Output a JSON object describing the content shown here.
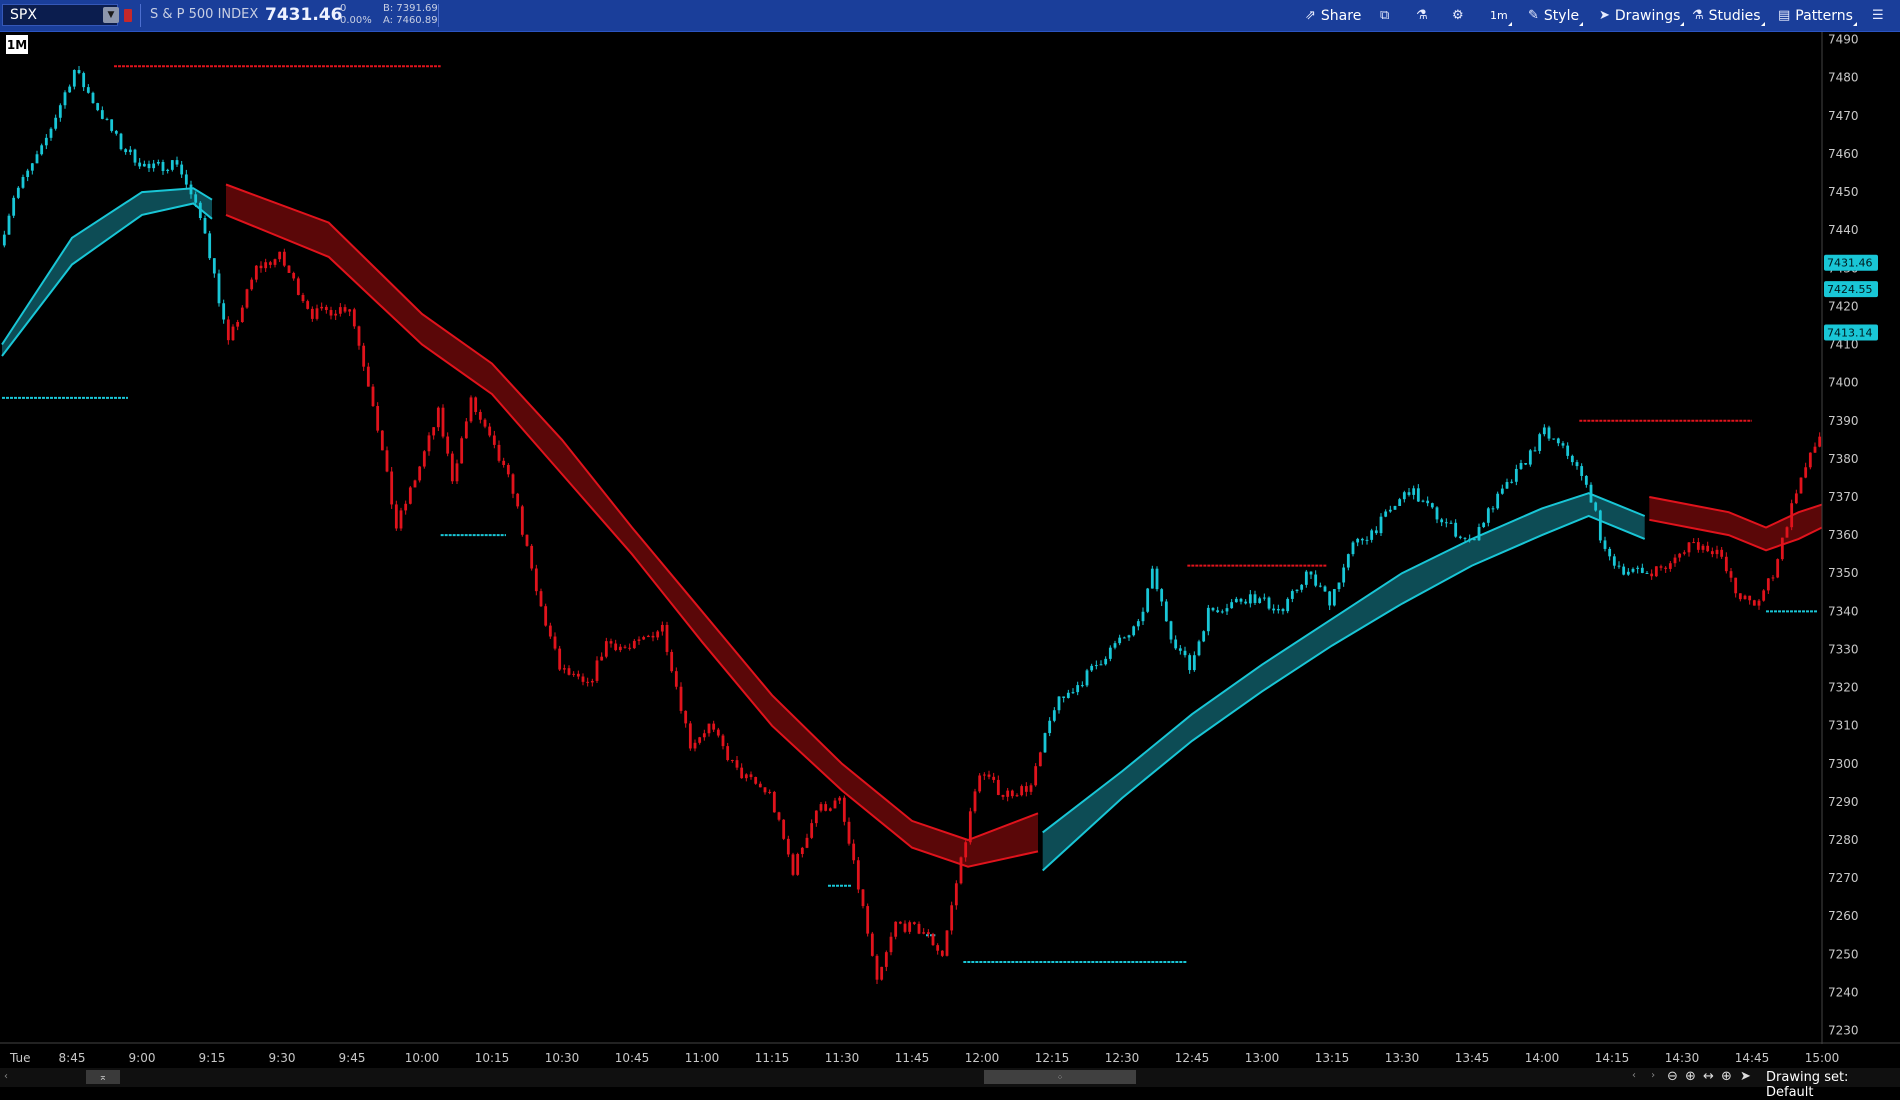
{
  "toolbar": {
    "symbol": "SPX",
    "description": "S & P 500 INDEX",
    "last_price": "7431.46",
    "net_change": "0",
    "pct_change": "0.00%",
    "bid": "B: 7391.69",
    "ask": "A: 7460.89",
    "buttons": {
      "share": "Share",
      "interval": "1m",
      "style": "Style",
      "drawings": "Drawings",
      "studies": "Studies",
      "patterns": "Patterns"
    }
  },
  "chart": {
    "aggregation": "1M",
    "day_label": "Tue",
    "price_labels": [
      {
        "value": "7431.46",
        "price": 7431.46
      },
      {
        "value": "7424.55",
        "price": 7424.55
      },
      {
        "value": "7413.14",
        "price": 7413.14
      }
    ],
    "colors": {
      "background": "#000000",
      "up": "#19c6d6",
      "down": "#e0131c",
      "band_up_fill": "#0d4c55",
      "band_down_fill": "#5a0708",
      "axis_text": "#c8c8c8"
    }
  },
  "chart_data": {
    "type": "candlestick",
    "symbol": "SPX",
    "interval": "1 minute",
    "y_ticks": [
      7230,
      7240,
      7250,
      7260,
      7270,
      7280,
      7290,
      7300,
      7310,
      7320,
      7330,
      7340,
      7350,
      7360,
      7370,
      7380,
      7390,
      7400,
      7410,
      7420,
      7430,
      7440,
      7450,
      7460,
      7470,
      7480,
      7490
    ],
    "ylim": [
      7227,
      7492
    ],
    "x_ticks": [
      "8:45",
      "9:00",
      "9:15",
      "9:30",
      "9:45",
      "10:00",
      "10:15",
      "10:30",
      "10:45",
      "11:00",
      "11:15",
      "11:30",
      "11:45",
      "12:00",
      "12:15",
      "12:30",
      "12:45",
      "13:00",
      "13:15",
      "13:30",
      "13:45",
      "14:00",
      "14:15",
      "14:30",
      "14:45",
      "15:00"
    ],
    "price_path": [
      {
        "t": "8:30",
        "p": 7436
      },
      {
        "t": "8:33",
        "p": 7449
      },
      {
        "t": "8:39",
        "p": 7461
      },
      {
        "t": "8:46",
        "p": 7482
      },
      {
        "t": "8:51",
        "p": 7472
      },
      {
        "t": "8:56",
        "p": 7462
      },
      {
        "t": "9:02",
        "p": 7456
      },
      {
        "t": "9:08",
        "p": 7458
      },
      {
        "t": "9:14",
        "p": 7440
      },
      {
        "t": "9:19",
        "p": 7410
      },
      {
        "t": "9:25",
        "p": 7430
      },
      {
        "t": "9:30",
        "p": 7433
      },
      {
        "t": "9:37",
        "p": 7418
      },
      {
        "t": "9:45",
        "p": 7420
      },
      {
        "t": "9:50",
        "p": 7395
      },
      {
        "t": "9:55",
        "p": 7362
      },
      {
        "t": "10:00",
        "p": 7378
      },
      {
        "t": "10:04",
        "p": 7392
      },
      {
        "t": "10:07",
        "p": 7375
      },
      {
        "t": "10:11",
        "p": 7395
      },
      {
        "t": "10:15",
        "p": 7385
      },
      {
        "t": "10:20",
        "p": 7372
      },
      {
        "t": "10:25",
        "p": 7345
      },
      {
        "t": "10:30",
        "p": 7325
      },
      {
        "t": "10:36",
        "p": 7320
      },
      {
        "t": "10:40",
        "p": 7332
      },
      {
        "t": "10:45",
        "p": 7330
      },
      {
        "t": "10:52",
        "p": 7336
      },
      {
        "t": "10:58",
        "p": 7305
      },
      {
        "t": "11:02",
        "p": 7310
      },
      {
        "t": "11:08",
        "p": 7298
      },
      {
        "t": "11:15",
        "p": 7292
      },
      {
        "t": "11:20",
        "p": 7272
      },
      {
        "t": "11:25",
        "p": 7288
      },
      {
        "t": "11:30",
        "p": 7290
      },
      {
        "t": "11:35",
        "p": 7262
      },
      {
        "t": "11:38",
        "p": 7242
      },
      {
        "t": "11:42",
        "p": 7258
      },
      {
        "t": "11:48",
        "p": 7256
      },
      {
        "t": "11:52",
        "p": 7250
      },
      {
        "t": "11:56",
        "p": 7275
      },
      {
        "t": "12:00",
        "p": 7298
      },
      {
        "t": "12:05",
        "p": 7292
      },
      {
        "t": "12:11",
        "p": 7294
      },
      {
        "t": "12:16",
        "p": 7315
      },
      {
        "t": "12:22",
        "p": 7322
      },
      {
        "t": "12:28",
        "p": 7330
      },
      {
        "t": "12:34",
        "p": 7336
      },
      {
        "t": "12:37",
        "p": 7350
      },
      {
        "t": "12:41",
        "p": 7334
      },
      {
        "t": "12:45",
        "p": 7325
      },
      {
        "t": "12:49",
        "p": 7340
      },
      {
        "t": "12:58",
        "p": 7344
      },
      {
        "t": "13:05",
        "p": 7340
      },
      {
        "t": "13:10",
        "p": 7350
      },
      {
        "t": "13:15",
        "p": 7343
      },
      {
        "t": "13:20",
        "p": 7357
      },
      {
        "t": "13:25",
        "p": 7362
      },
      {
        "t": "13:32",
        "p": 7372
      },
      {
        "t": "13:38",
        "p": 7365
      },
      {
        "t": "13:45",
        "p": 7358
      },
      {
        "t": "13:50",
        "p": 7368
      },
      {
        "t": "13:55",
        "p": 7376
      },
      {
        "t": "14:01",
        "p": 7387
      },
      {
        "t": "14:07",
        "p": 7380
      },
      {
        "t": "14:11",
        "p": 7370
      },
      {
        "t": "14:14",
        "p": 7355
      },
      {
        "t": "14:18",
        "p": 7351
      },
      {
        "t": "14:22",
        "p": 7350
      },
      {
        "t": "14:28",
        "p": 7352
      },
      {
        "t": "14:32",
        "p": 7358
      },
      {
        "t": "14:38",
        "p": 7356
      },
      {
        "t": "14:42",
        "p": 7345
      },
      {
        "t": "14:46",
        "p": 7341
      },
      {
        "t": "14:50",
        "p": 7350
      },
      {
        "t": "14:55",
        "p": 7372
      },
      {
        "t": "15:00",
        "p": 7386
      }
    ],
    "band": [
      {
        "t": "8:30",
        "top": 7410,
        "bot": 7407
      },
      {
        "t": "8:45",
        "top": 7438,
        "bot": 7431
      },
      {
        "t": "9:00",
        "top": 7450,
        "bot": 7444
      },
      {
        "t": "9:11",
        "top": 7451,
        "bot": 7447
      },
      {
        "t": "9:15",
        "top": 7448,
        "bot": 7443
      },
      {
        "t": "9:18",
        "top": 7452,
        "bot": 7444
      },
      {
        "t": "9:40",
        "top": 7442,
        "bot": 7433
      },
      {
        "t": "10:00",
        "top": 7418,
        "bot": 7410
      },
      {
        "t": "10:15",
        "top": 7405,
        "bot": 7397
      },
      {
        "t": "10:30",
        "top": 7385,
        "bot": 7376
      },
      {
        "t": "10:45",
        "top": 7362,
        "bot": 7355
      },
      {
        "t": "11:00",
        "top": 7340,
        "bot": 7332
      },
      {
        "t": "11:15",
        "top": 7318,
        "bot": 7310
      },
      {
        "t": "11:30",
        "top": 7300,
        "bot": 7293
      },
      {
        "t": "11:45",
        "top": 7285,
        "bot": 7278
      },
      {
        "t": "11:57",
        "top": 7280,
        "bot": 7273
      },
      {
        "t": "12:12",
        "top": 7287,
        "bot": 7277
      },
      {
        "t": "12:13",
        "top": 7282,
        "bot": 7272
      },
      {
        "t": "12:30",
        "top": 7298,
        "bot": 7291
      },
      {
        "t": "12:45",
        "top": 7313,
        "bot": 7306
      },
      {
        "t": "13:00",
        "top": 7326,
        "bot": 7319
      },
      {
        "t": "13:15",
        "top": 7338,
        "bot": 7331
      },
      {
        "t": "13:30",
        "top": 7350,
        "bot": 7342
      },
      {
        "t": "13:45",
        "top": 7359,
        "bot": 7352
      },
      {
        "t": "14:00",
        "top": 7367,
        "bot": 7360
      },
      {
        "t": "14:10",
        "top": 7371,
        "bot": 7365
      },
      {
        "t": "14:22",
        "top": 7365,
        "bot": 7359
      },
      {
        "t": "14:23",
        "top": 7370,
        "bot": 7364
      },
      {
        "t": "14:40",
        "top": 7366,
        "bot": 7360
      },
      {
        "t": "14:48",
        "top": 7362,
        "bot": 7356
      },
      {
        "t": "14:55",
        "top": 7366,
        "bot": 7359
      },
      {
        "t": "15:00",
        "top": 7368,
        "bot": 7362
      }
    ],
    "band_colors": [
      {
        "from": "8:30",
        "to": "9:15",
        "trend": "up"
      },
      {
        "from": "9:18",
        "to": "12:12",
        "trend": "down"
      },
      {
        "from": "12:13",
        "to": "14:22",
        "trend": "up"
      },
      {
        "from": "14:23",
        "to": "15:00",
        "trend": "down"
      }
    ],
    "levels": [
      {
        "price": 7483,
        "from": "8:54",
        "to": "10:04",
        "color": "down"
      },
      {
        "price": 7396,
        "from": "8:30",
        "to": "8:57",
        "color": "up"
      },
      {
        "price": 7360,
        "from": "10:04",
        "to": "10:18",
        "color": "up"
      },
      {
        "price": 7268,
        "from": "11:27",
        "to": "11:32",
        "color": "up"
      },
      {
        "price": 7255,
        "from": "11:48",
        "to": "11:50",
        "color": "up"
      },
      {
        "price": 7248,
        "from": "11:56",
        "to": "12:44",
        "color": "up"
      },
      {
        "price": 7352,
        "from": "12:44",
        "to": "13:14",
        "color": "down"
      },
      {
        "price": 7390,
        "from": "14:08",
        "to": "14:45",
        "color": "down"
      },
      {
        "price": 7340,
        "from": "14:48",
        "to": "14:59",
        "color": "up"
      }
    ]
  },
  "status": {
    "drawing_set": "Drawing set: Default"
  }
}
